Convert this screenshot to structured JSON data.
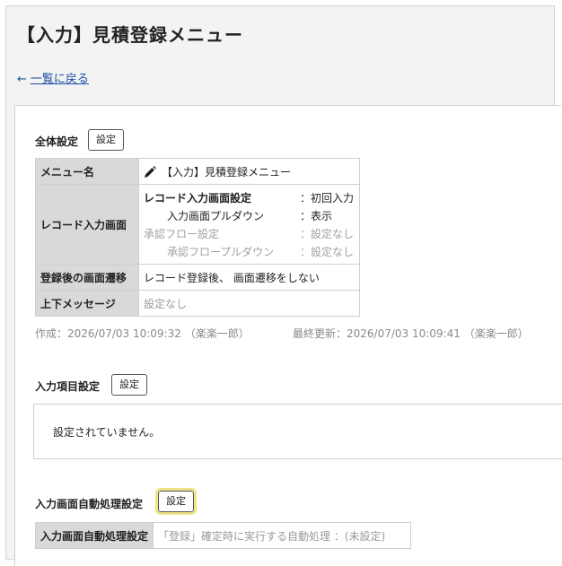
{
  "header": {
    "title": "【入力】見積登録メニュー",
    "back_label": "一覧に戻る",
    "back_icon": "arrow-left-icon"
  },
  "general": {
    "label": "全体設定",
    "button": "設定",
    "rows": {
      "menu_name": {
        "header": "メニュー名",
        "value": "【入力】見積登録メニュー",
        "icon": "pencil-icon"
      },
      "record_input": {
        "header": "レコード入力画面",
        "items": [
          {
            "key": "レコード入力画面設定",
            "value": "：初回入力"
          },
          {
            "key": "入力画面プルダウン",
            "value": "：表示"
          },
          {
            "key": "承認フロー設定",
            "value": "：設定なし"
          },
          {
            "key": "承認フロープルダウン",
            "value": "：設定なし"
          }
        ]
      },
      "after_register": {
        "header": "登録後の画面遷移",
        "value": "レコード登録後、 画面遷移をしない"
      },
      "messages": {
        "header": "上下メッセージ",
        "value": "設定なし"
      }
    },
    "created": "作成：2026/07/03 10:09:32 （楽楽一郎）",
    "updated": "最終更新：2026/07/03 10:09:41 （楽楽一郎）"
  },
  "input_items": {
    "label": "入力項目設定",
    "button": "設定",
    "empty_text": "設定されていません。"
  },
  "auto_process": {
    "label": "入力画面自動処理設定",
    "button": "設定",
    "row_header": "入力画面自動処理設定",
    "row_value": "「登録」確定時に実行する自動処理 ：(未設定)"
  },
  "colors": {
    "link": "#1a4fa0",
    "highlight": "#ede38a",
    "table_header_bg": "#d9d9d9"
  }
}
